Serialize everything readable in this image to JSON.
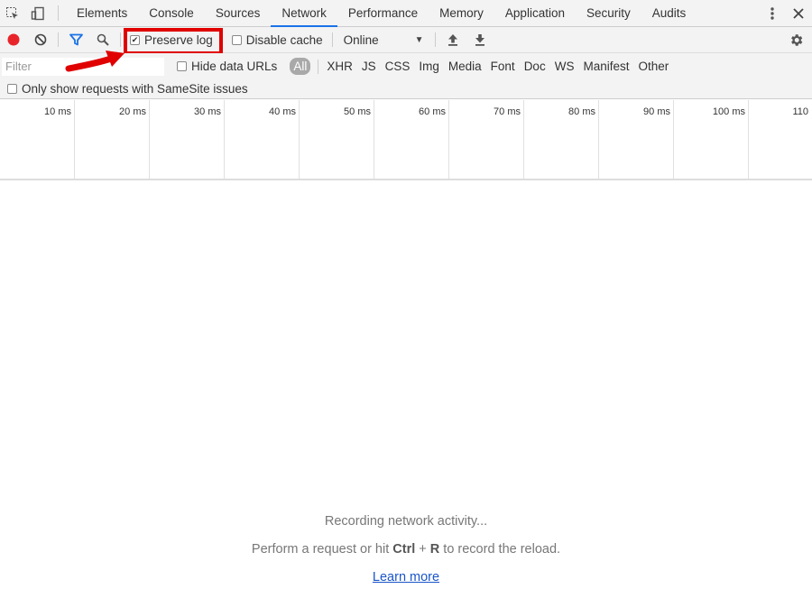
{
  "tabs": [
    "Elements",
    "Console",
    "Sources",
    "Network",
    "Performance",
    "Memory",
    "Application",
    "Security",
    "Audits"
  ],
  "active_tab": "Network",
  "toolbar": {
    "preserve_log": "Preserve log",
    "disable_cache": "Disable cache",
    "throttling": "Online"
  },
  "filter": {
    "placeholder": "Filter",
    "hide_data_urls": "Hide data URLs",
    "types": [
      "All",
      "XHR",
      "JS",
      "CSS",
      "Img",
      "Media",
      "Font",
      "Doc",
      "WS",
      "Manifest",
      "Other"
    ],
    "samesite": "Only show requests with SameSite issues"
  },
  "timeline_ticks": [
    "10 ms",
    "20 ms",
    "30 ms",
    "40 ms",
    "50 ms",
    "60 ms",
    "70 ms",
    "80 ms",
    "90 ms",
    "100 ms",
    "110"
  ],
  "empty_state": {
    "recording": "Recording network activity...",
    "perform_prefix": "Perform a request or hit ",
    "ctrl": "Ctrl",
    "plus": " + ",
    "r": "R",
    "perform_suffix": " to record the reload.",
    "learn_more": "Learn more"
  },
  "colors": {
    "record": "#e8242b",
    "filter_active": "#1a73e8",
    "highlight": "#e00000",
    "link": "#1a55c9"
  }
}
